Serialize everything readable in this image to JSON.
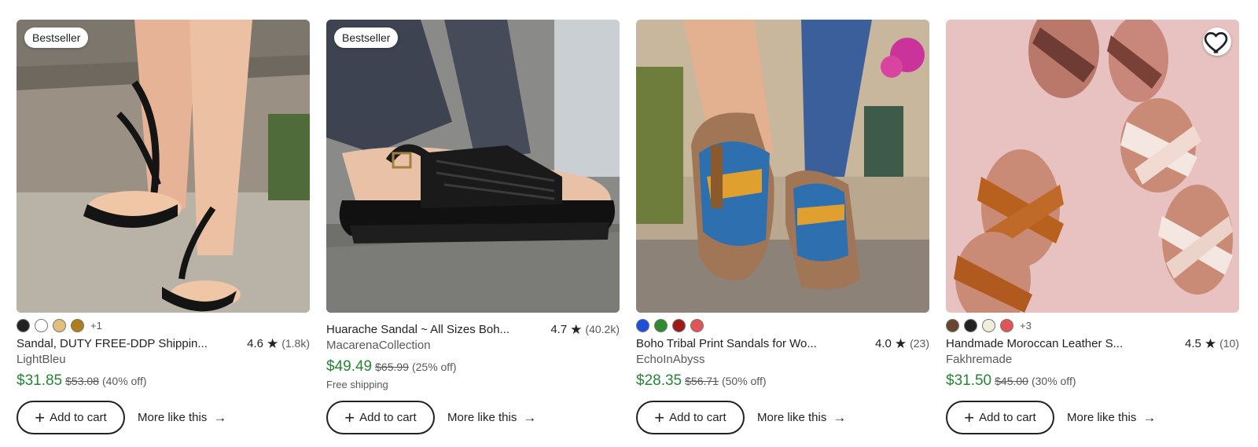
{
  "listings": [
    {
      "badge": "Bestseller",
      "swatches": [
        "#222222",
        "#ffffff",
        "#e3c07a",
        "#b07d1c"
      ],
      "swatch_more": "+1",
      "title": "Sandal, DUTY FREE-DDP Shippin...",
      "rating": "4.6",
      "reviews": "(1.8k)",
      "shop": "LightBleu",
      "price": "$31.85",
      "original_price": "$53.08",
      "discount": "(40% off)",
      "shipping": "",
      "add_to_cart": "Add to cart",
      "more_like_this": "More like this",
      "image_icon": "sandal-photo-icon"
    },
    {
      "badge": "Bestseller",
      "swatches": [],
      "swatch_more": "",
      "title": "Huarache Sandal ~ All Sizes Boh...",
      "rating": "4.7",
      "reviews": "(40.2k)",
      "shop": "MacarenaCollection",
      "price": "$49.49",
      "original_price": "$65.99",
      "discount": "(25% off)",
      "shipping": "Free shipping",
      "add_to_cart": "Add to cart",
      "more_like_this": "More like this",
      "image_icon": "sandal-photo-icon"
    },
    {
      "badge": "",
      "swatches": [
        "#1d4fd8",
        "#2e8b2e",
        "#9e1a1a",
        "#e05555"
      ],
      "swatch_more": "",
      "title": "Boho Tribal Print Sandals for Wo...",
      "rating": "4.0",
      "reviews": "(23)",
      "shop": "EchoInAbyss",
      "price": "$28.35",
      "original_price": "$56.71",
      "discount": "(50% off)",
      "shipping": "",
      "add_to_cart": "Add to cart",
      "more_like_this": "More like this",
      "image_icon": "sandal-photo-icon"
    },
    {
      "badge": "",
      "swatches": [
        "#6b4430",
        "#222222",
        "#f1eedb",
        "#e05555"
      ],
      "swatch_more": "+3",
      "title": "Handmade Moroccan Leather S...",
      "rating": "4.5",
      "reviews": "(10)",
      "shop": "Fakhremade",
      "price": "$31.50",
      "original_price": "$45.00",
      "discount": "(30% off)",
      "shipping": "",
      "add_to_cart": "Add to cart",
      "more_like_this": "More like this",
      "image_icon": "sandal-photo-icon",
      "favorite_icon": "heart-icon"
    }
  ],
  "colors": {
    "price_green": "#258635",
    "text": "#222222",
    "muted": "#595959"
  }
}
